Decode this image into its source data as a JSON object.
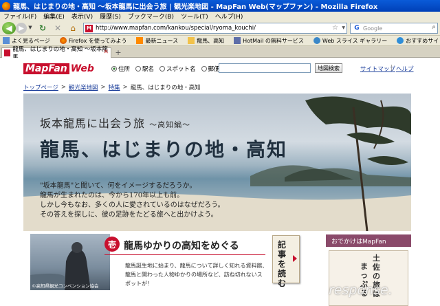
{
  "window": {
    "title": "龍馬、はじまりの地・高知 〜坂本龍馬に出会う旅 | 観光楽地図 - MapFan Web(マップファン) - Mozilla Firefox"
  },
  "menu": [
    "ファイル(F)",
    "編集(E)",
    "表示(V)",
    "履歴(S)",
    "ブックマーク(B)",
    "ツール(T)",
    "ヘルプ(H)"
  ],
  "navbar": {
    "url": "http://www.mapfan.com/kankou/special/ryoma_kouchi/",
    "favicon_letter": "M",
    "search_placeholder": "Google",
    "search_engine_letter": "G"
  },
  "bookmarks": [
    {
      "label": "よく見るページ",
      "icon": "page-icon"
    },
    {
      "label": "Firefox を使ってみよう",
      "icon": "firefox-icon"
    },
    {
      "label": "最新ニュース",
      "icon": "rss-icon"
    },
    {
      "label": "龍馬、高知",
      "icon": "folder-icon"
    },
    {
      "label": "HotMail の無料サービス",
      "icon": "hotmail-icon"
    },
    {
      "label": "Web スライス ギャラリー",
      "icon": "web-slice-icon"
    },
    {
      "label": "おすすめサイト",
      "icon": "ie-icon"
    }
  ],
  "tab": {
    "label": "龍馬、はじまりの地・高知 〜坂本龍馬...",
    "new_tab": "+"
  },
  "site": {
    "logo_m": "MapFan",
    "logo_w": "Web",
    "search_options": [
      "住所",
      "駅名",
      "スポット名",
      "郵便番号"
    ],
    "search_selected": 0,
    "search_button": "地図検索",
    "sitemap": "サイトマップ",
    "sep": "|",
    "help": "ヘルプ"
  },
  "breadcrumb": {
    "items": [
      "トップページ",
      "観光楽地図",
      "特集"
    ],
    "current": "龍馬、はじまりの地・高知",
    "sep": ">"
  },
  "hero": {
    "subtitle": "坂本龍馬に出会う旅",
    "subtitle_small": "〜高知編〜",
    "title": "龍馬、はじまりの地・高知",
    "lines": [
      "\"坂本龍馬\"と聞いて、何をイメージするだろうか。",
      "龍馬が生まれたのは、今から170年以上も前。",
      "しかし今もなお、多くの人に愛されているのはなぜだろう。",
      "その答えを探しに、彼の足跡をたどる旅へと出かけよう。"
    ]
  },
  "section": {
    "badge": "壱",
    "title": "龍馬ゆかりの高知をめぐる",
    "credit": "©高知県観光コンベンション協会",
    "lines": [
      "龍馬誕生地に始まり、龍馬について詳しく知れる資料館、",
      "龍馬と関わった人物ゆかりの場所など、訪ね切れないス",
      "ポットが！"
    ],
    "scroll_text": "記事を読む"
  },
  "sidebar": {
    "header": "おでかけはMapFan",
    "v1": "土佐の旅は",
    "v2": "まっぷる"
  },
  "watermark": "response."
}
